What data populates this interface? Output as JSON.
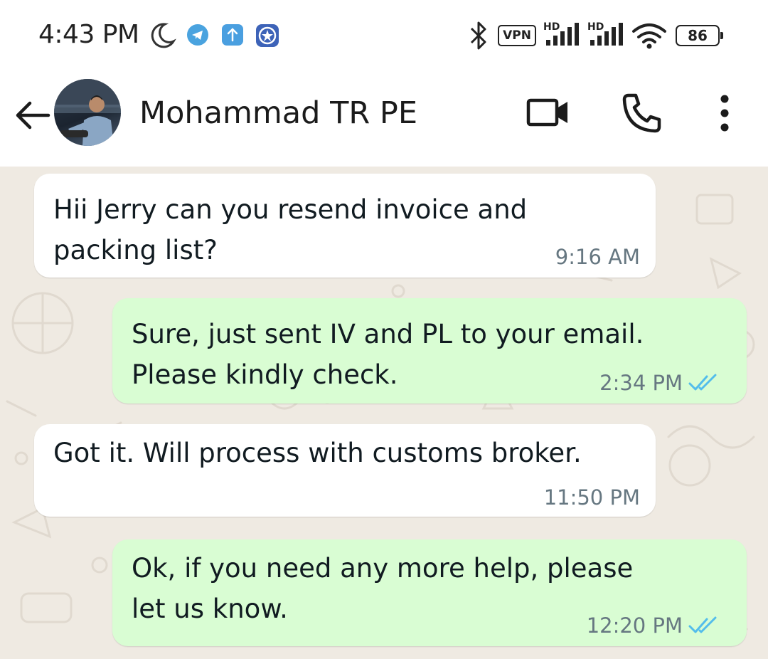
{
  "status_bar": {
    "time": "4:43 PM",
    "icons": [
      "moon-icon",
      "telegram-icon",
      "upload-icon",
      "star-badge-icon",
      "bluetooth-icon",
      "vpn-badge",
      "signal-icon",
      "signal-icon",
      "wifi-icon",
      "battery-icon"
    ],
    "vpn_label": "VPN",
    "signal1_label": "HD",
    "signal2_label": "HD",
    "battery_level": "86"
  },
  "header": {
    "contact_name": "Mohammad TR PE",
    "actions": [
      "back-arrow-icon",
      "video-call-icon",
      "voice-call-icon",
      "more-options-icon"
    ]
  },
  "messages": [
    {
      "direction": "incoming",
      "text": "Hii Jerry can you resend invoice and\npacking list?",
      "time": "9:16 AM"
    },
    {
      "direction": "outgoing",
      "text": "Sure, just sent IV and PL to your email.\nPlease kindly check.",
      "time": "2:34 PM",
      "status": "read"
    },
    {
      "direction": "incoming",
      "text": "Got it. Will process with customs broker.",
      "time": "11:50 PM"
    },
    {
      "direction": "outgoing",
      "text": "Ok, if you need any more help, please\nlet us know.",
      "time": "12:20 PM",
      "status": "read"
    }
  ],
  "colors": {
    "chat_background": "#efeae2",
    "incoming_bubble": "#ffffff",
    "outgoing_bubble": "#d9fdd3",
    "read_ticks": "#53bdeb",
    "meta_text": "#667781"
  }
}
